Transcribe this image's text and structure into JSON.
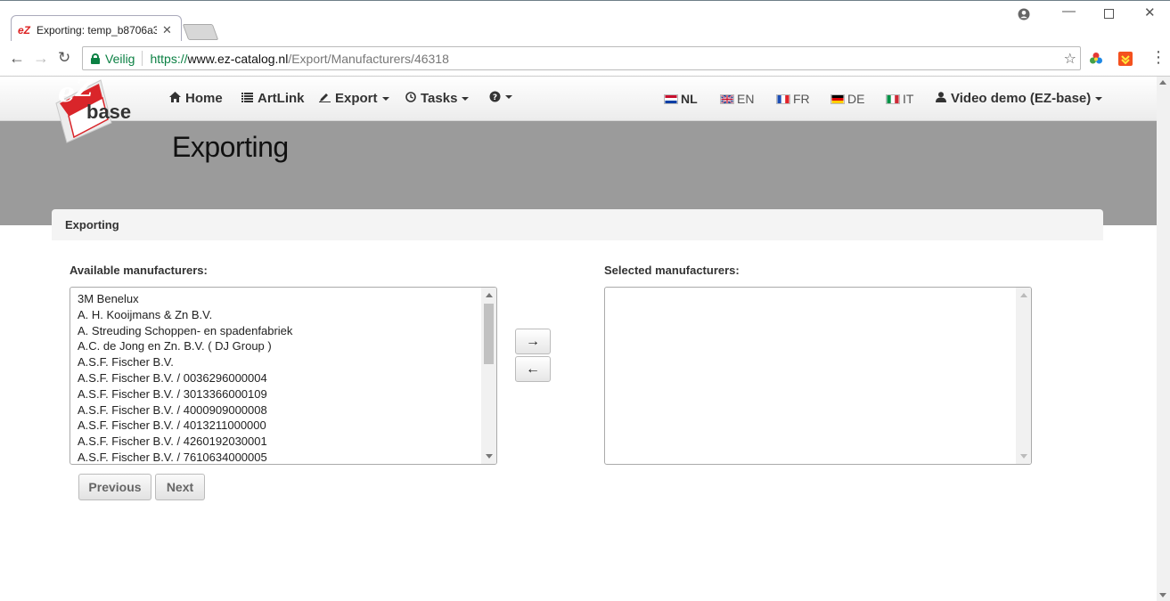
{
  "browser": {
    "tab_title": "Exporting: temp_b8706a3",
    "security_label": "Veilig",
    "url_scheme": "https://",
    "url_host": "www.ez-catalog.nl",
    "url_path": "/Export/Manufacturers/46318"
  },
  "nav": {
    "home": "Home",
    "artlink": "ArtLink",
    "export": "Export",
    "tasks": "Tasks",
    "help_icon": "question-circle-icon",
    "languages": [
      "NL",
      "EN",
      "FR",
      "DE",
      "IT"
    ],
    "active_language": "NL",
    "user": "Video demo (EZ-base)"
  },
  "logo": {
    "text": "base"
  },
  "page": {
    "title": "Exporting",
    "panel_heading": "Exporting",
    "available_label": "Available manufacturers:",
    "selected_label": "Selected manufacturers:",
    "available_items": [
      "3M Benelux",
      "A. H. Kooijmans & Zn B.V.",
      "A. Streuding Schoppen- en spadenfabriek",
      "A.C. de Jong en Zn. B.V. ( DJ Group )",
      "A.S.F. Fischer B.V.",
      "A.S.F. Fischer B.V. / 0036296000004",
      "A.S.F. Fischer B.V. / 3013366000109",
      "A.S.F. Fischer B.V. / 4000909000008",
      "A.S.F. Fischer B.V. / 4013211000000",
      "A.S.F. Fischer B.V. / 4260192030001",
      "A.S.F. Fischer B.V. / 7610634000005"
    ],
    "selected_items": [],
    "add_arrow": "→",
    "remove_arrow": "←",
    "previous": "Previous",
    "next": "Next"
  },
  "colors": {
    "header_band": "#9b9b9b",
    "secure_green": "#0b8043",
    "logo_red": "#d9252a"
  }
}
